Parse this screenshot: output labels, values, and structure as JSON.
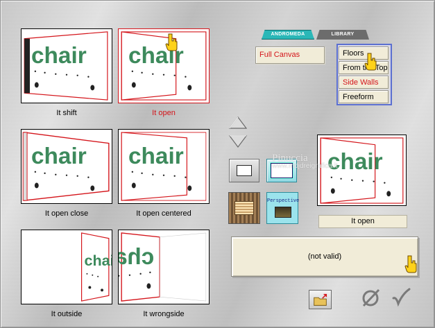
{
  "presets": [
    {
      "label": "It shift",
      "selected": false,
      "variant": "shift"
    },
    {
      "label": "It open",
      "selected": true,
      "variant": "open"
    },
    {
      "label": "It open close",
      "selected": false,
      "variant": "openclose"
    },
    {
      "label": "It open centered",
      "selected": false,
      "variant": "centered"
    },
    {
      "label": "It outside",
      "selected": false,
      "variant": "outside"
    },
    {
      "label": "It wrongside",
      "selected": false,
      "variant": "wrongside"
    }
  ],
  "tabs": {
    "active": "ANDROMEDA",
    "inactive": "LIBRARY"
  },
  "mode": {
    "label": "Full Canvas"
  },
  "submenu": [
    "Floors",
    "From the Top",
    "Side Walls",
    "Freeform"
  ],
  "submenu_selected": "Side Walls",
  "thumbnail_word": "chair",
  "perspective_button_label": "Perspective",
  "preview": {
    "label": "It open"
  },
  "status": {
    "text": "(not valid)"
  },
  "watermark": {
    "line1": "Pinuccia",
    "line2": "www.mdjdreigrafica.it"
  },
  "colors": {
    "accent_red": "#d4141a",
    "selection_blue": "#5b6fd0",
    "tab_teal": "#2ab7b7",
    "panel_beige": "#f1ecd8",
    "chair_green": "#3d8a5c"
  }
}
